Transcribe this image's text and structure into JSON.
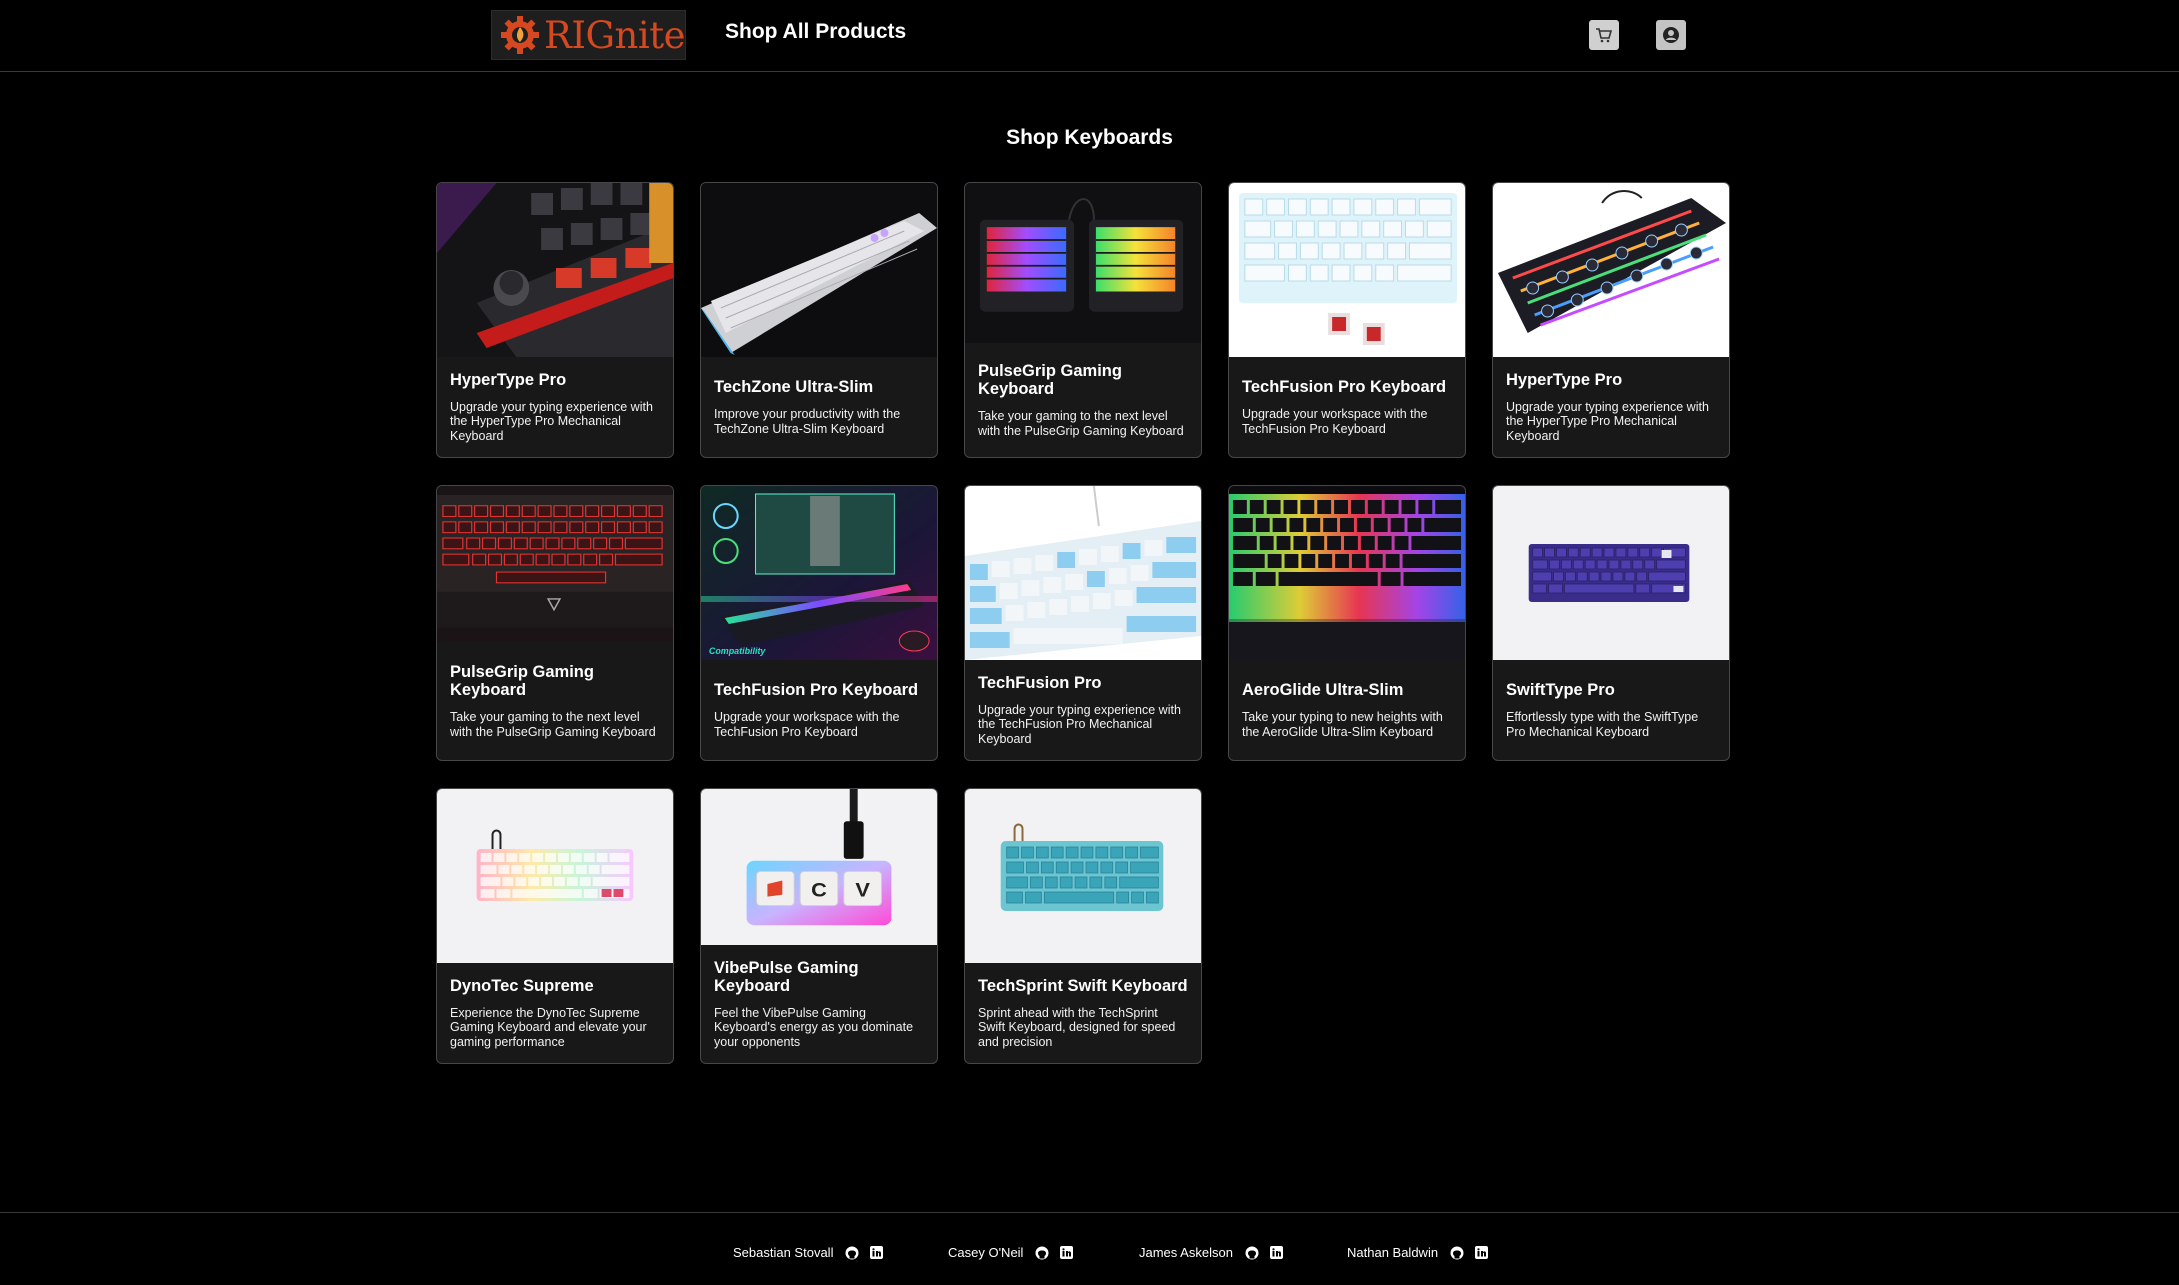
{
  "header": {
    "logo_text": "RIGnite",
    "nav_label": "Shop All Products",
    "cart_icon": "cart-icon",
    "account_icon": "user-circle-icon"
  },
  "main": {
    "section_title": "Shop Keyboards",
    "products": [
      {
        "title": "HyperType Pro",
        "description": "Upgrade your typing experience with the HyperType Pro Mechanical Keyboard"
      },
      {
        "title": "TechZone Ultra-Slim",
        "description": "Improve your productivity with the TechZone Ultra-Slim Keyboard"
      },
      {
        "title": "PulseGrip Gaming Keyboard",
        "description": "Take your gaming to the next level with the PulseGrip Gaming Keyboard"
      },
      {
        "title": "TechFusion Pro Keyboard",
        "description": "Upgrade your workspace with the TechFusion Pro Keyboard"
      },
      {
        "title": "HyperType Pro",
        "description": "Upgrade your typing experience with the HyperType Pro Mechanical Keyboard"
      },
      {
        "title": "PulseGrip Gaming Keyboard",
        "description": "Take your gaming to the next level with the PulseGrip Gaming Keyboard"
      },
      {
        "title": "TechFusion Pro Keyboard",
        "description": "Upgrade your workspace with the TechFusion Pro Keyboard"
      },
      {
        "title": "TechFusion Pro",
        "description": "Upgrade your typing experience with the TechFusion Pro Mechanical Keyboard"
      },
      {
        "title": "AeroGlide Ultra-Slim",
        "description": "Take your typing to new heights with the AeroGlide Ultra-Slim Keyboard"
      },
      {
        "title": "SwiftType Pro",
        "description": "Effortlessly type with the SwiftType Pro Mechanical Keyboard"
      },
      {
        "title": "DynoTec Supreme",
        "description": "Experience the DynoTec Supreme Gaming Keyboard and elevate your gaming performance"
      },
      {
        "title": "VibePulse Gaming Keyboard",
        "description": "Feel the VibePulse Gaming Keyboard's energy as you dominate your opponents"
      },
      {
        "title": "TechSprint Swift Keyboard",
        "description": "Sprint ahead with the TechSprint Swift Keyboard, designed for speed and precision"
      }
    ]
  },
  "footer": {
    "authors": [
      {
        "name": "Sebastian Stovall"
      },
      {
        "name": "Casey O'Neil"
      },
      {
        "name": "James Askelson"
      },
      {
        "name": "Nathan Baldwin"
      }
    ]
  },
  "colors": {
    "background": "#000000",
    "card_background": "#181818",
    "card_border": "#474747",
    "brand_accent": "#d6481f"
  }
}
